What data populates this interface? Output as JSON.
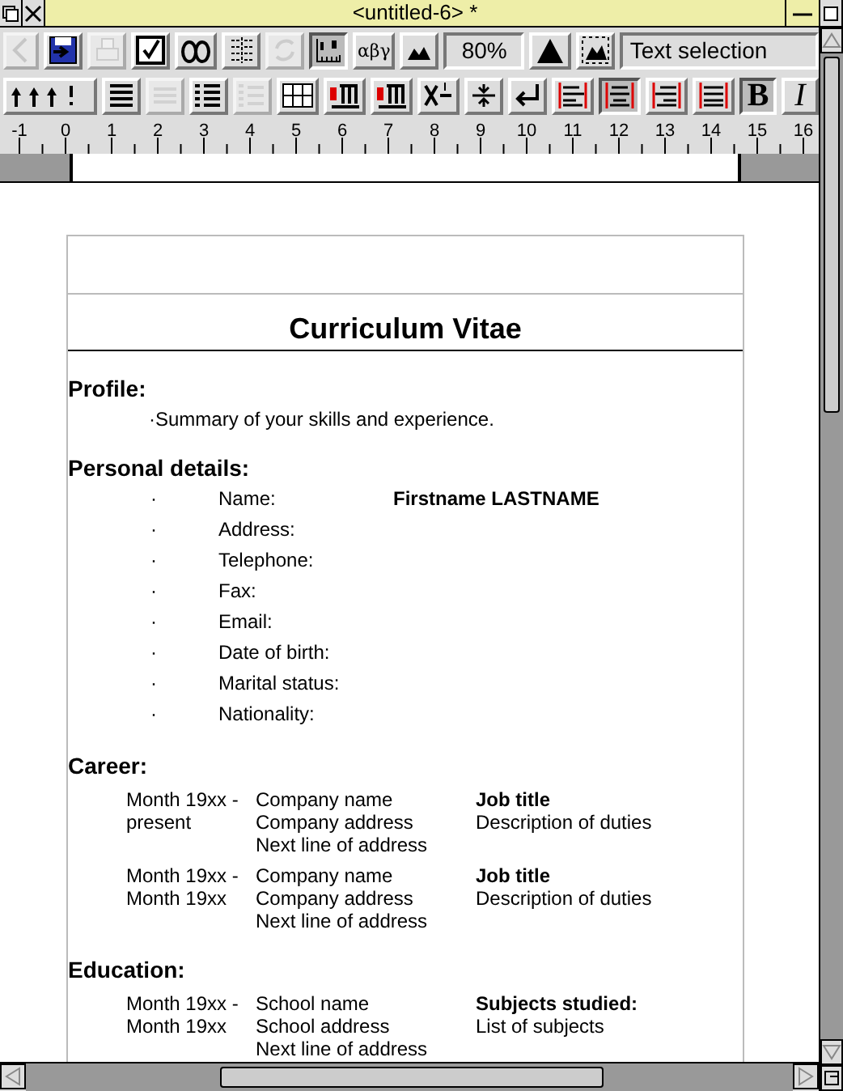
{
  "window": {
    "title": "<untitled-6> *"
  },
  "toolbar_top": {
    "buttons": [
      {
        "disabled": true,
        "pressed": false
      },
      {
        "disabled": false,
        "pressed": false
      },
      {
        "disabled": true,
        "pressed": false
      },
      {
        "disabled": false,
        "pressed": false
      },
      {
        "disabled": false,
        "pressed": false
      },
      {
        "disabled": false,
        "pressed": false
      },
      {
        "disabled": true,
        "pressed": false
      },
      {
        "disabled": false,
        "pressed": true
      },
      {
        "disabled": false,
        "pressed": false,
        "label": "αβγ"
      },
      {
        "disabled": false,
        "pressed": false
      }
    ],
    "zoom": "80%",
    "zoom_buttons": [
      {
        "pressed": false
      },
      {
        "pressed": false
      }
    ],
    "mode": "Text selection"
  },
  "toolbar_format": {
    "buttons": [
      {
        "disabled": false,
        "pressed": false
      },
      {
        "disabled": false,
        "pressed": false
      },
      {
        "disabled": true,
        "pressed": false
      },
      {
        "disabled": false,
        "pressed": false
      },
      {
        "disabled": true,
        "pressed": false
      },
      {
        "disabled": false,
        "pressed": false
      },
      {
        "disabled": false,
        "pressed": false
      },
      {
        "disabled": false,
        "pressed": false
      },
      {
        "disabled": false,
        "pressed": false
      },
      {
        "disabled": false,
        "pressed": false
      },
      {
        "disabled": false,
        "pressed": false
      }
    ],
    "alignment": [
      {
        "selected": false
      },
      {
        "selected": true
      },
      {
        "selected": false
      },
      {
        "selected": false
      }
    ],
    "bold": {
      "label": "B",
      "pressed": true
    },
    "italic": {
      "label": "I",
      "pressed": false
    }
  },
  "ruler_labels": [
    "-1",
    "0",
    "1",
    "2",
    "3",
    "4",
    "5",
    "6",
    "7",
    "8",
    "9",
    "10",
    "11",
    "12",
    "13",
    "14",
    "15",
    "16"
  ],
  "document": {
    "title": "Curriculum Vitae",
    "profile": {
      "heading": "Profile:",
      "summary": "·Summary of your skills and experience."
    },
    "personal": {
      "heading": "Personal details:",
      "rows": [
        {
          "bullet": "·",
          "label": "Name:",
          "value": "Firstname LASTNAME"
        },
        {
          "bullet": "·",
          "label": "Address:"
        },
        {
          "bullet": "·",
          "label": "Telephone:"
        },
        {
          "bullet": "·",
          "label": "Fax:"
        },
        {
          "bullet": "·",
          "label": "Email:"
        },
        {
          "bullet": "·",
          "label": "Date of birth:"
        },
        {
          "bullet": "·",
          "label": "Marital status:"
        },
        {
          "bullet": "·",
          "label": "Nationality:"
        }
      ]
    },
    "career": {
      "heading": "Career:",
      "entries": [
        {
          "dates": [
            "Month 19xx -",
            "present"
          ],
          "place": [
            "Company name",
            "Company address",
            "Next line of address"
          ],
          "title": "Job title",
          "detail": "Description of duties"
        },
        {
          "dates": [
            "Month 19xx -",
            "Month 19xx"
          ],
          "place": [
            "Company name",
            "Company address",
            "Next line of address"
          ],
          "title": "Job title",
          "detail": "Description of duties"
        }
      ]
    },
    "education": {
      "heading": "Education:",
      "entries": [
        {
          "dates": [
            "Month 19xx -",
            "Month 19xx"
          ],
          "place": [
            "School name",
            "School address",
            "Next line of address"
          ],
          "title": "Subjects studied:",
          "detail": "List of subjects"
        }
      ]
    }
  }
}
